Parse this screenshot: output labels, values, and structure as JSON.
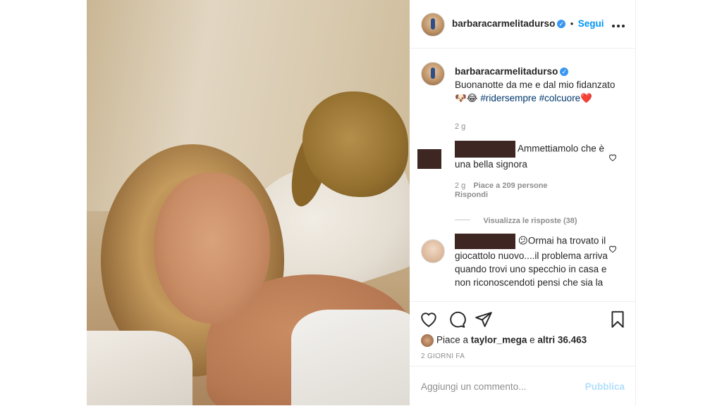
{
  "post": {
    "username": "barbaracarmelitadurso",
    "follow_label": "Segui",
    "more_icon": "more-horizontal-icon"
  },
  "caption": {
    "username": "barbaracarmelitadurso",
    "text": "Buonanotte da me e dal mio fidanzato 🐶😂",
    "hashtag1": "#ridersempre",
    "hashtag2": "#colcuore",
    "heart_emoji": "❤️",
    "time": "2 g"
  },
  "comments": [
    {
      "text": "Ammettiamolo che è una bella signora",
      "time": "2 g",
      "likes": "Piace a 209 persone",
      "reply": "Rispondi",
      "view_replies": "Visualizza le risposte (38)"
    },
    {
      "text": "😕Ormai ha trovato il giocattolo nuovo....il problema arriva quando trovi uno specchio in casa e non riconoscendoti pensi che sia la"
    }
  ],
  "likes": {
    "prefix": "Piace a",
    "user": "taylor_mega",
    "middle": "e",
    "others": "altri 36.463"
  },
  "timestamp": "2 GIORNI FA",
  "add_comment": {
    "placeholder": "Aggiungi un commento...",
    "publish": "Pubblica"
  },
  "colors": {
    "link_blue": "#0095f6",
    "hashtag": "#00376b",
    "muted": "#8e8e8e",
    "publish_disabled": "#b2dffc",
    "redaction": "#3e2723"
  }
}
